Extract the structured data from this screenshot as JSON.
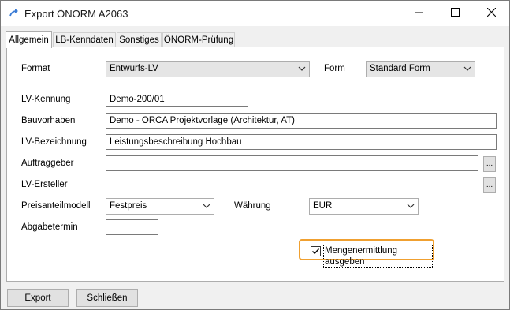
{
  "window": {
    "title": "Export ÖNORM A2063",
    "icon": "orca-export-icon",
    "minimize_icon": "minimize-icon",
    "maximize_icon": "maximize-icon",
    "close_icon": "close-icon"
  },
  "tabs": [
    {
      "label": "Allgemein",
      "active": true
    },
    {
      "label": "LB-Kenndaten",
      "active": false
    },
    {
      "label": "Sonstiges",
      "active": false
    },
    {
      "label": "ÖNORM-Prüfung",
      "active": false
    }
  ],
  "form": {
    "format_label": "Format",
    "format_value": "Entwurfs-LV",
    "form_label": "Form",
    "form_value": "Standard Form",
    "lv_kennung_label": "LV-Kennung",
    "lv_kennung_value": "Demo-200/01",
    "bauvorhaben_label": "Bauvorhaben",
    "bauvorhaben_value": "Demo - ORCA Projektvorlage (Architektur, AT)",
    "lv_bezeichnung_label": "LV-Bezeichnung",
    "lv_bezeichnung_value": "Leistungsbeschreibung Hochbau",
    "auftraggeber_label": "Auftraggeber",
    "auftraggeber_value": "",
    "lv_ersteller_label": "LV-Ersteller",
    "lv_ersteller_value": "",
    "browse_label": "...",
    "preisanteilmodell_label": "Preisanteilmodell",
    "preisanteilmodell_value": "Festpreis",
    "waehrung_label": "Währung",
    "waehrung_value": "EUR",
    "abgabetermin_label": "Abgabetermin",
    "abgabetermin_value": "",
    "mengenermittlung_label": "Mengenermittlung ausgeben",
    "mengenermittlung_checked": true
  },
  "buttons": {
    "export": "Export",
    "close": "Schließen"
  },
  "colors": {
    "highlight": "#f0a030",
    "tab_border": "#adadad"
  }
}
